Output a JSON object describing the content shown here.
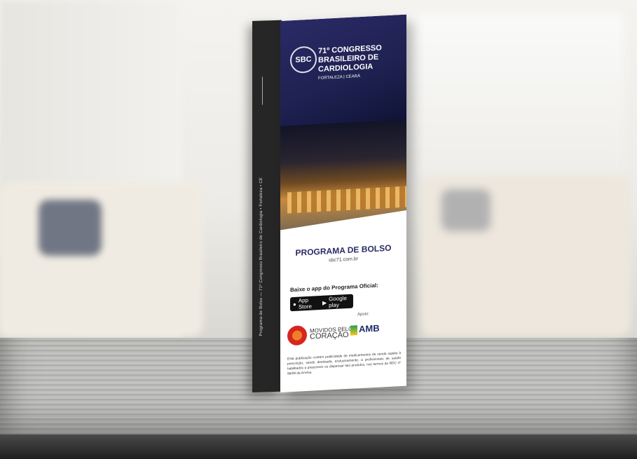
{
  "scene": {
    "description_colors": {
      "cover_blue": "#23255a",
      "accent_orange": "#f07f2a",
      "amb_blue": "#1f2b6a"
    }
  },
  "book": {
    "spine_text": "Programa de Bolso — 71º Congresso Brasileiro de Cardiologia • Fortaleza • CE",
    "seal_text": "SBC",
    "congress_title": "71º Congresso Brasileiro de Cardiologia",
    "congress_location": "Fortaleza | Ceará",
    "program_title": "PROGRAMA DE BOLSO",
    "url": "sbc71.com.br",
    "app_label": "Baixe o app do Programa Oficial:",
    "apple_store_label": "App Store",
    "google_play_label": "Google play",
    "support_label": "Apoio:",
    "movidos_line1": "MOVIDOS PELO",
    "movidos_line2": "CORAÇÃO",
    "amb_label": "AMB",
    "disclaimer": "Esta publicação contém publicidade de medicamentos de venda sujeita à prescrição, sendo destinada, exclusivamente, a profissionais de saúde habilitados a prescrever ou dispensar tais produtos, nos termos da RDC nº 96/08 da Anvisa."
  }
}
